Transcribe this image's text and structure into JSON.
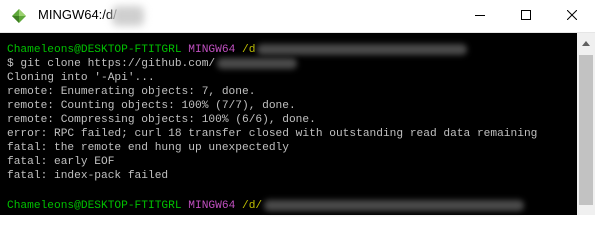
{
  "window": {
    "title": "MINGW64:/d/",
    "colors": {
      "background": "#000000",
      "text": "#c0c0c0",
      "prompt_user": "#00c000",
      "prompt_system": "#c050c0",
      "prompt_path": "#c0c000"
    },
    "controls": {
      "minimize_icon": "minimize-icon",
      "maximize_icon": "maximize-icon",
      "close_icon": "close-icon"
    }
  },
  "terminal": {
    "prompt1": {
      "user": "Chameleons@DESKTOP-FTITGRL",
      "system": "MINGW64",
      "path": "/d"
    },
    "command": "$ git clone https://github.com/",
    "output": [
      "Cloning into '-Api'...",
      "remote: Enumerating objects: 7, done.",
      "remote: Counting objects: 100% (7/7), done.",
      "remote: Compressing objects: 100% (6/6), done.",
      "error: RPC failed; curl 18 transfer closed with outstanding read data remaining",
      "fatal: the remote end hung up unexpectedly",
      "fatal: early EOF",
      "fatal: index-pack failed"
    ],
    "prompt2": {
      "user": "Chameleons@DESKTOP-FTITGRL",
      "system": "MINGW64",
      "path": "/d/"
    }
  }
}
